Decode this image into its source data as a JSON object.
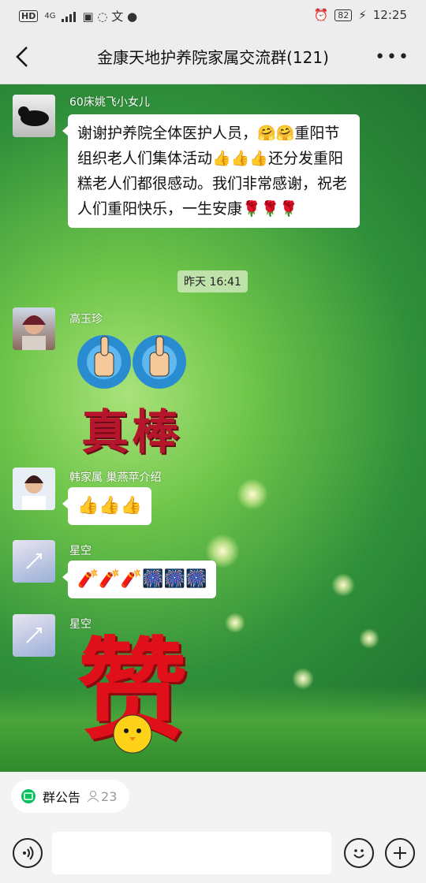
{
  "status_bar": {
    "network": "4G",
    "hd": "HD",
    "battery": "82",
    "time": "12:25"
  },
  "nav": {
    "title": "金康天地护养院家属交流群(121)"
  },
  "messages": [
    {
      "sender": "60床姚飞小女儿",
      "text": "谢谢护养院全体医护人员，🤗🤗重阳节组织老人们集体活动👍👍👍还分发重阳糕老人们都很感动。我们非常感谢，祝老人们重阳快乐，一生安康🌹🌹🌹"
    },
    {
      "time": "昨天 16:41"
    },
    {
      "sender": "高玉珍",
      "sticker_text": "真棒"
    },
    {
      "sender": "韩家属 巢燕苹介绍",
      "text": "👍👍👍"
    },
    {
      "sender": "星空",
      "text": "🧨🧨🧨🎆🎆🎆"
    },
    {
      "sender": "星空",
      "sticker_text": "赞"
    }
  ],
  "bottom": {
    "notice_label": "群公告",
    "member_count": "23"
  },
  "colors": {
    "accent": "#07c160",
    "sticker_red": "#b5162b"
  }
}
